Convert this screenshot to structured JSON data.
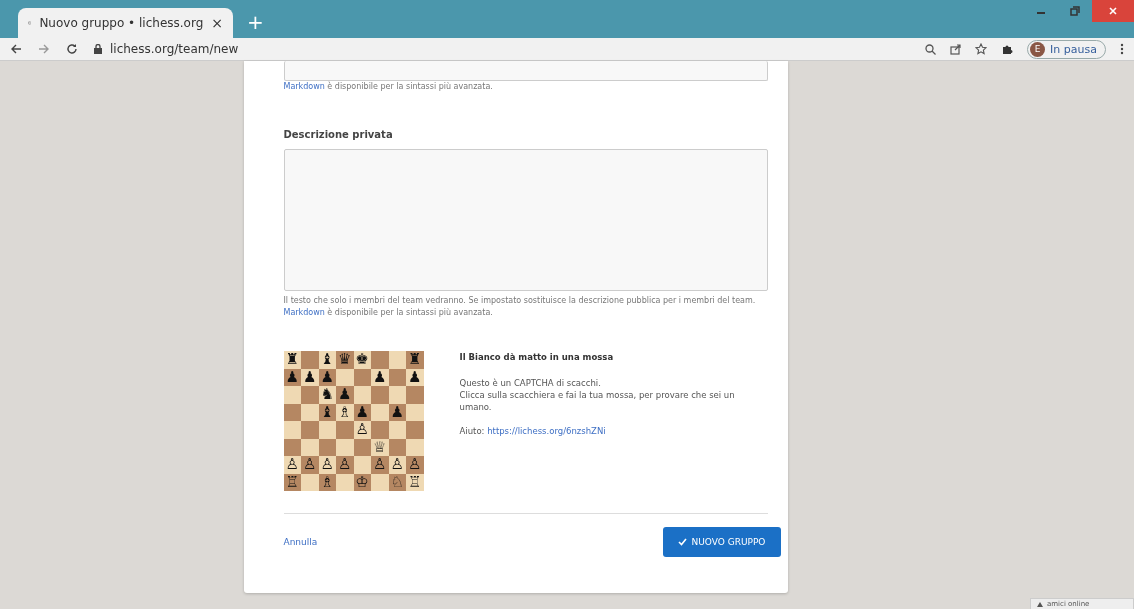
{
  "browser": {
    "tab": {
      "title": "Nuovo gruppo • lichess.org",
      "close": "×",
      "new_tab": "+"
    },
    "address": "lichess.org/team/new",
    "profile": {
      "initial": "E",
      "status": "In pausa"
    }
  },
  "form": {
    "top_field": {
      "markdown_link": "Markdown",
      "hint": " è disponibile per la sintassi più avanzata."
    },
    "private_description": {
      "label": "Descrizione privata",
      "help": "Il testo che solo i membri del team vedranno. Se impostato sostituisce la descrizione pubblica per i membri del team.",
      "markdown_link": "Markdown",
      "hint": " è disponibile per la sintassi più avanzata."
    },
    "captcha": {
      "title": "Il Bianco dà matto in una mossa",
      "line_1": "Questo è un CAPTCHA di scacchi.",
      "line_2": "Clicca sulla scacchiera e fai la tua mossa, per provare che sei un umano.",
      "help_label": "Aiuto: ",
      "help_link": "https://lichess.org/6nzshZNi",
      "board": [
        {
          "squares": [
            {
              "color": "#efd9b3",
              "piece": "♜"
            },
            {
              "color": "#b58762"
            },
            {
              "color": "#efd9b3",
              "piece": "♝"
            },
            {
              "color": "#b58762",
              "piece": "♛"
            },
            {
              "color": "#efd9b3",
              "piece": "♚"
            },
            {
              "color": "#b58762"
            },
            {
              "color": "#efd9b3"
            },
            {
              "color": "#b58762",
              "piece": "♜"
            }
          ]
        },
        {
          "squares": [
            {
              "color": "#b58762",
              "piece": "♟"
            },
            {
              "color": "#efd9b3",
              "piece": "♟"
            },
            {
              "color": "#b58762",
              "piece": "♟"
            },
            {
              "color": "#efd9b3"
            },
            {
              "color": "#b58762"
            },
            {
              "color": "#efd9b3",
              "piece": "♟"
            },
            {
              "color": "#b58762"
            },
            {
              "color": "#efd9b3",
              "piece": "♟"
            }
          ]
        },
        {
          "squares": [
            {
              "color": "#efd9b3"
            },
            {
              "color": "#b58762"
            },
            {
              "color": "#efd9b3",
              "piece": "♞"
            },
            {
              "color": "#b58762",
              "piece": "♟"
            },
            {
              "color": "#efd9b3"
            },
            {
              "color": "#b58762"
            },
            {
              "color": "#efd9b3"
            },
            {
              "color": "#b58762"
            }
          ]
        },
        {
          "squares": [
            {
              "color": "#b58762"
            },
            {
              "color": "#efd9b3"
            },
            {
              "color": "#b58762",
              "piece": "♝"
            },
            {
              "color": "#efd9b3",
              "piece": "♗"
            },
            {
              "color": "#b58762",
              "piece": "♟"
            },
            {
              "color": "#efd9b3"
            },
            {
              "color": "#b58762",
              "piece": "♟"
            },
            {
              "color": "#efd9b3"
            }
          ]
        },
        {
          "squares": [
            {
              "color": "#efd9b3"
            },
            {
              "color": "#b58762"
            },
            {
              "color": "#efd9b3"
            },
            {
              "color": "#b58762"
            },
            {
              "color": "#efd9b3",
              "piece": "♙"
            },
            {
              "color": "#b58762"
            },
            {
              "color": "#efd9b3"
            },
            {
              "color": "#b58762"
            }
          ]
        },
        {
          "squares": [
            {
              "color": "#b58762"
            },
            {
              "color": "#efd9b3"
            },
            {
              "color": "#b58762"
            },
            {
              "color": "#efd9b3"
            },
            {
              "color": "#b58762"
            },
            {
              "color": "#efd9b3",
              "piece": "♕"
            },
            {
              "color": "#b58762"
            },
            {
              "color": "#efd9b3"
            }
          ]
        },
        {
          "squares": [
            {
              "color": "#efd9b3",
              "piece": "♙"
            },
            {
              "color": "#b58762",
              "piece": "♙"
            },
            {
              "color": "#efd9b3",
              "piece": "♙"
            },
            {
              "color": "#b58762",
              "piece": "♙"
            },
            {
              "color": "#efd9b3"
            },
            {
              "color": "#b58762",
              "piece": "♙"
            },
            {
              "color": "#efd9b3",
              "piece": "♙"
            },
            {
              "color": "#b58762",
              "piece": "♙"
            }
          ]
        },
        {
          "squares": [
            {
              "color": "#b58762",
              "piece": "♖"
            },
            {
              "color": "#efd9b3"
            },
            {
              "color": "#b58762",
              "piece": "♗"
            },
            {
              "color": "#efd9b3"
            },
            {
              "color": "#b58762",
              "piece": "♔"
            },
            {
              "color": "#efd9b3"
            },
            {
              "color": "#b58762",
              "piece": "♘"
            },
            {
              "color": "#efd9b3",
              "piece": "♖"
            }
          ]
        }
      ]
    },
    "cancel": "Annulla",
    "submit": "NUOVO GRUPPO"
  },
  "friends_tab": "amici online"
}
